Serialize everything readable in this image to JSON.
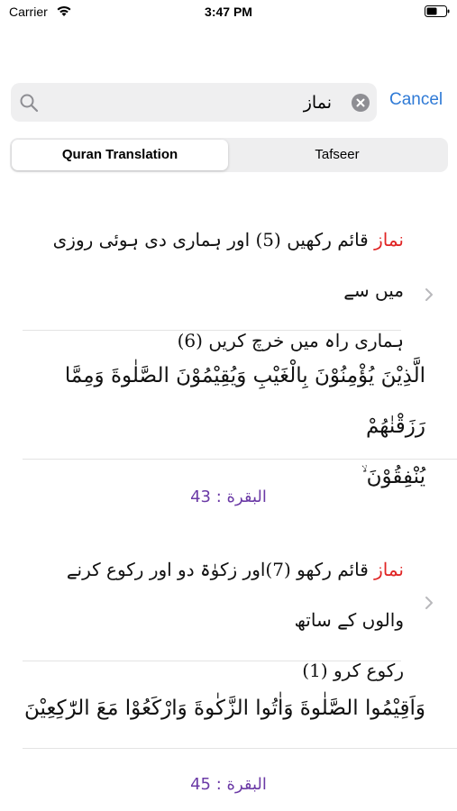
{
  "status": {
    "carrier": "Carrier",
    "time": "3:47 PM"
  },
  "search": {
    "query": "نماز",
    "placeholder": "",
    "cancel_label": "Cancel"
  },
  "tabs": [
    {
      "label": "Quran Translation",
      "selected": true
    },
    {
      "label": "Tafseer",
      "selected": false
    }
  ],
  "results": [
    {
      "highlight": "نماز",
      "translation_line1": " قائم رکھیں (5) اور ہماری دی ہوئی روزی میں سے",
      "translation_line2": "ہماری راہ میں خرچ کریں (6)",
      "arabic_line1": "الَّذِيْنَ يُؤْمِنُوْنَ بِالْغَيْبِ وَيُقِيْمُوْنَ الصَّلٰوةَ وَمِمَّا رَزَقْنٰهُمْ",
      "arabic_line2": "يُنْفِقُوْنَ ۙ",
      "reference": "البقرة : 43"
    },
    {
      "highlight": "نماز",
      "translation_line1": " قائم رکھو (7)اور زکوٰۃ دو اور رکوع کرنے والوں کے ساتھ",
      "translation_line2": "رکوع کرو (1)",
      "arabic_line1": "وَاَقِيْمُوا الصَّلٰوةَ وَاٰتُوا الزَّكٰوةَ وَارْكَعُوْا مَعَ الرّٰكِعِيْنَ",
      "arabic_line2": "",
      "reference": "البقرة : 45"
    }
  ],
  "colors": {
    "accent": "#2f7ad6",
    "highlight": "#e02525",
    "reference": "#6b3aa6"
  }
}
